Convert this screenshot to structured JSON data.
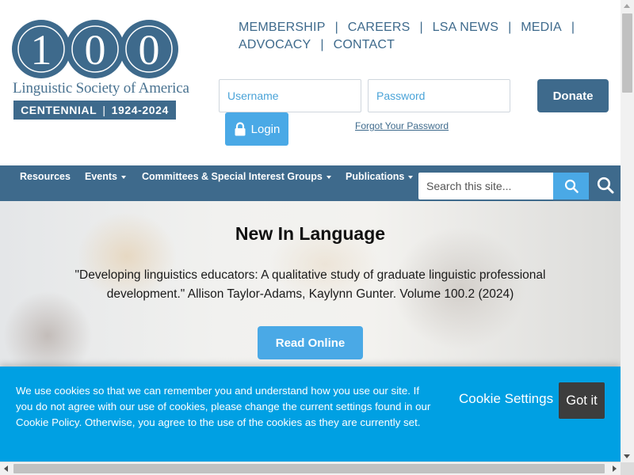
{
  "logo": {
    "digits": [
      "1",
      "0",
      "0"
    ],
    "society": "Linguistic Society of America",
    "banner_left": "CENTENNIAL",
    "banner_sep": "|",
    "banner_right": "1924-2024"
  },
  "top_links": {
    "row1": [
      "MEMBERSHIP",
      "CAREERS",
      "LSA NEWS",
      "MEDIA"
    ],
    "row2": [
      "ADVOCACY",
      "CONTACT"
    ],
    "separator": "|"
  },
  "login": {
    "username_placeholder": "Username",
    "password_placeholder": "Password",
    "login_label": "Login",
    "forgot_label": "Forgot Your Password",
    "donate_label": "Donate"
  },
  "nav": {
    "items": [
      {
        "label": "Resources",
        "dropdown": false
      },
      {
        "label": "Events",
        "dropdown": true
      },
      {
        "label": "Committees & Special Interest Groups",
        "dropdown": true
      },
      {
        "label": "Publications",
        "dropdown": true
      }
    ],
    "search_placeholder": "Search this site...",
    "search_icon": "search-icon",
    "search_toggle_icon": "search-icon"
  },
  "hero": {
    "title": "New In Language",
    "text": "\"Developing linguistics educators: A qualitative study of graduate linguistic professional development.\" Allison Taylor-Adams, Kaylynn Gunter. Volume 100.2 (2024)",
    "button_label": "Read Online"
  },
  "cookie": {
    "text": "We use cookies so that we can remember you and understand how you use our site. If you do not agree with our use of cookies, please change the current settings found in our Cookie Policy. Otherwise, you agree to the use of the cookies as they are currently set.",
    "settings_label": "Cookie Settings",
    "accept_label": "Got it"
  },
  "colors": {
    "primary": "#3e6a8c",
    "accent": "#4aa9e6",
    "cookie_bg": "#00a0e3",
    "button_dark": "#3d3d3d"
  }
}
